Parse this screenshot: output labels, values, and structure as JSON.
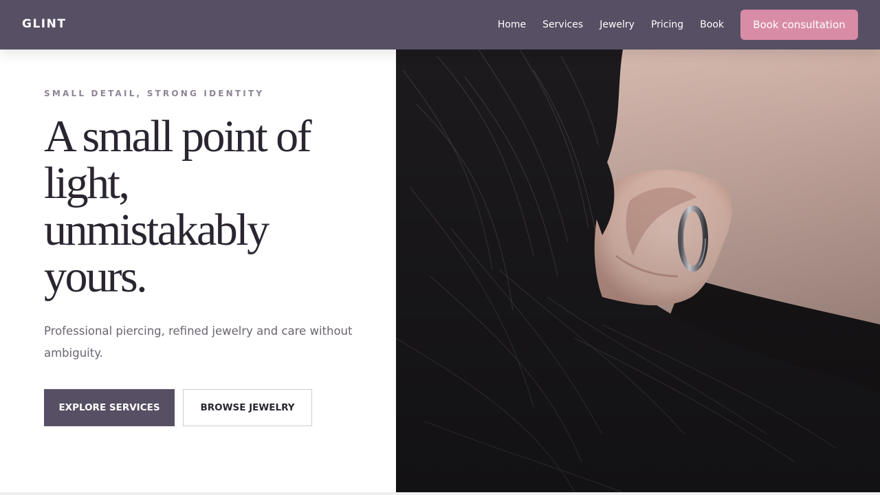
{
  "header": {
    "logo": "GLINT",
    "nav": [
      "Home",
      "Services",
      "Jewelry",
      "Pricing",
      "Book"
    ],
    "cta_label": "Book consultation"
  },
  "hero": {
    "eyebrow": "SMALL DETAIL, STRONG IDENTITY",
    "headline": "A small point of light, unmistakably yours.",
    "lede": "Professional piercing, refined jewelry and care without ambiguity.",
    "primary_button": "EXPLORE SERVICES",
    "secondary_button": "BROWSE JEWELRY",
    "image_alt": "Close-up of an ear with a silver hoop earring framed by dark hair"
  },
  "colors": {
    "header_bg": "#574f63",
    "accent_pink": "#d98ca6",
    "headline": "#2a2530",
    "eyebrow": "#8e8496",
    "body_text": "#6b6470"
  }
}
